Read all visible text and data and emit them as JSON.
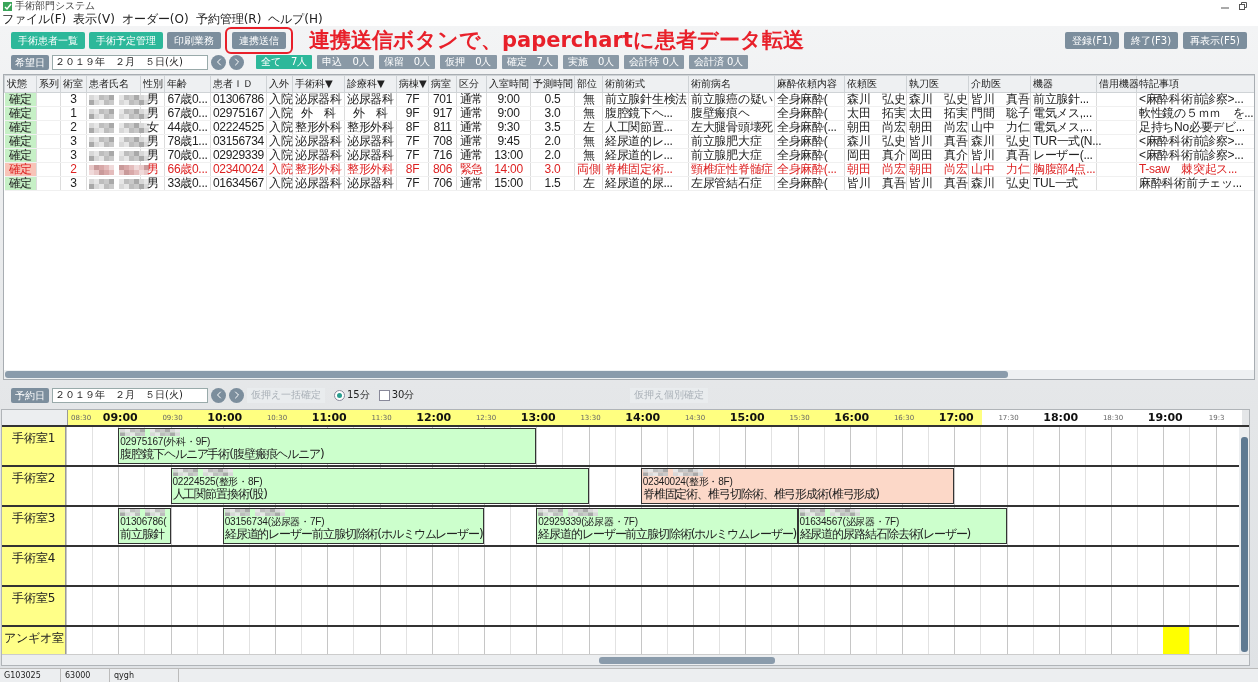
{
  "window": {
    "title": "手術部門システム"
  },
  "menu": [
    "ファイル(F)",
    "表示(V)",
    "オーダー(O)",
    "予約管理(R)",
    "ヘルプ(H)"
  ],
  "toolbar": {
    "buttons": [
      {
        "label": "手術患者一覧",
        "kind": "nav",
        "highlighted": false
      },
      {
        "label": "手術予定管理",
        "kind": "nav",
        "highlighted": false
      },
      {
        "label": "印刷業務",
        "kind": "action",
        "highlighted": false
      },
      {
        "label": "連携送信",
        "kind": "action",
        "highlighted": true
      }
    ],
    "annotation": "連携送信ボタンで、paperchartに患者データ転送",
    "right_buttons": [
      "登録(F1)",
      "終了(F3)",
      "再表示(F5)"
    ]
  },
  "filter_bar": {
    "label": "希望日",
    "date": "２０１９年　２月　５日(火)",
    "filters": [
      {
        "label": "全て　7人",
        "selected": true
      },
      {
        "label": "申込　0人",
        "selected": false
      },
      {
        "label": "保留　0人",
        "selected": false
      },
      {
        "label": "仮押　0人",
        "selected": false
      },
      {
        "label": "確定　7人",
        "selected": false
      },
      {
        "label": "実施　0人",
        "selected": false
      },
      {
        "label": "会計待 0人",
        "selected": false
      },
      {
        "label": "会計済 0人",
        "selected": false
      }
    ]
  },
  "table": {
    "columns": [
      {
        "label": "状態",
        "kind": "text"
      },
      {
        "label": "系列",
        "kind": "text"
      },
      {
        "label": "術室",
        "kind": "text"
      },
      {
        "label": "患者氏名",
        "kind": "redacted"
      },
      {
        "label": "性別",
        "kind": "text"
      },
      {
        "label": "年齢",
        "kind": "text"
      },
      {
        "label": "患者ＩＤ",
        "kind": "text"
      },
      {
        "label": "入外",
        "kind": "text"
      },
      {
        "label": "手術科▼",
        "kind": "text"
      },
      {
        "label": "診療科▼",
        "kind": "text"
      },
      {
        "label": "病棟▼",
        "kind": "text"
      },
      {
        "label": "病室",
        "kind": "text"
      },
      {
        "label": "区分",
        "kind": "text"
      },
      {
        "label": "入室時間",
        "kind": "text"
      },
      {
        "label": "予測時間",
        "kind": "text"
      },
      {
        "label": "部位",
        "kind": "text"
      },
      {
        "label": "術前術式",
        "kind": "text"
      },
      {
        "label": "術前病名",
        "kind": "text"
      },
      {
        "label": "麻酔依頼内容",
        "kind": "text"
      },
      {
        "label": "依頼医",
        "kind": "text"
      },
      {
        "label": "執刀医",
        "kind": "text"
      },
      {
        "label": "介助医",
        "kind": "text"
      },
      {
        "label": "機器",
        "kind": "text"
      },
      {
        "label": "借用機器",
        "kind": "text"
      },
      {
        "label": "特記事項",
        "kind": "text"
      }
    ],
    "rows": [
      {
        "alert": false,
        "cells": [
          "確定",
          null,
          "3",
          null,
          "男",
          "67歳0...",
          "01306786",
          "入院",
          "泌尿器科",
          "泌尿器科",
          "7F",
          "701",
          "通常",
          "9:00",
          "0.5",
          "無",
          "前立腺針生検法",
          "前立腺癌の疑い",
          "全身麻酔(",
          "森川　弘史",
          "森川　弘史",
          "皆川　真吾",
          "前立腺針...",
          null,
          "<麻酔科術前診察>..."
        ]
      },
      {
        "alert": false,
        "cells": [
          "確定",
          null,
          "1",
          null,
          "男",
          "67歳0...",
          "02975167",
          "入院",
          "外　科",
          "外　科",
          "9F",
          "917",
          "通常",
          "9:00",
          "3.0",
          "無",
          "腹腔鏡下ヘ...",
          "腹壁瘢痕ヘ",
          "全身麻酔(",
          "太田　拓実",
          "太田　拓実",
          "門間　聡子",
          "電気メス,...",
          null,
          "軟性鏡の５ｍｍ　を..."
        ]
      },
      {
        "alert": false,
        "cells": [
          "確定",
          null,
          "2",
          null,
          "女",
          "44歳0...",
          "02224525",
          "入院",
          "整形外科",
          "整形外科",
          "8F",
          "811",
          "通常",
          "9:30",
          "3.5",
          "左",
          "人工関節置...",
          "左大腿骨頭壊死",
          "全身麻酔(...",
          "朝田　尚宏",
          "朝田　尚宏",
          "山中　力仁",
          "電気メス,...",
          null,
          "足持ちNo必要デビ..."
        ]
      },
      {
        "alert": false,
        "cells": [
          "確定",
          null,
          "3",
          null,
          "男",
          "78歳1...",
          "03156734",
          "入院",
          "泌尿器科",
          "泌尿器科",
          "7F",
          "708",
          "通常",
          "9:45",
          "2.0",
          "無",
          "経尿道的レ...",
          "前立腺肥大症",
          "全身麻酔(",
          "森川　弘史",
          "皆川　真吾",
          "森川　弘史",
          "TUR一式(N...",
          null,
          "<麻酔科術前診察>..."
        ]
      },
      {
        "alert": false,
        "cells": [
          "確定",
          null,
          "3",
          null,
          "男",
          "70歳0...",
          "02929339",
          "入院",
          "泌尿器科",
          "泌尿器科",
          "7F",
          "716",
          "通常",
          "13:00",
          "2.0",
          "無",
          "経尿道的レ...",
          "前立腺肥大症",
          "全身麻酔(",
          "岡田　真介",
          "岡田　真介",
          "皆川　真吾",
          "レーザー(...",
          null,
          "<麻酔科術前診察>..."
        ]
      },
      {
        "alert": true,
        "cells": [
          "確定",
          null,
          "2",
          null,
          "男",
          "66歳0...",
          "02340024",
          "入院",
          "整形外科",
          "整形外科",
          "8F",
          "806",
          "緊急",
          "14:00",
          "3.0",
          "両側",
          "脊椎固定術...",
          "頸椎症性脊髄症",
          "全身麻酔(...",
          "朝田　尚宏",
          "朝田　尚宏",
          "山中　力仁",
          "胸腹部4点...",
          null,
          "T-saw　棘突起ス..."
        ]
      },
      {
        "alert": false,
        "cells": [
          "確定",
          null,
          "3",
          null,
          "男",
          "33歳0...",
          "01634567",
          "入院",
          "泌尿器科",
          "泌尿器科",
          "7F",
          "706",
          "通常",
          "15:00",
          "1.5",
          "左",
          "経尿道的尿...",
          "左尿管結石症",
          "全身麻酔(",
          "皆川　真吾",
          "皆川　真吾",
          "森川　弘史",
          "TUL一式",
          null,
          "麻酔科術前チェッ..."
        ]
      }
    ]
  },
  "schedule": {
    "label": "予約日",
    "date": "２０１９年　２月　５日(火)",
    "bulk_confirm": {
      "label": "仮押え一括確定",
      "disabled": true
    },
    "options": [
      {
        "kind": "radio",
        "label": "15分",
        "checked": true
      },
      {
        "kind": "checkbox",
        "label": "30分",
        "checked": false
      }
    ],
    "individual_confirm": {
      "label": "仮押え個別確定",
      "disabled": true
    },
    "ticks": [
      {
        "label": "08:30",
        "kind": "half",
        "highlighted": true
      },
      {
        "label": "09:00",
        "kind": "hour",
        "highlighted": true
      },
      {
        "label": "09:30",
        "kind": "half",
        "highlighted": true
      },
      {
        "label": "10:00",
        "kind": "hour",
        "highlighted": true
      },
      {
        "label": "10:30",
        "kind": "half",
        "highlighted": true
      },
      {
        "label": "11:00",
        "kind": "hour",
        "highlighted": true
      },
      {
        "label": "11:30",
        "kind": "half",
        "highlighted": true
      },
      {
        "label": "12:00",
        "kind": "hour",
        "highlighted": true
      },
      {
        "label": "12:30",
        "kind": "half",
        "highlighted": true
      },
      {
        "label": "13:00",
        "kind": "hour",
        "highlighted": true
      },
      {
        "label": "13:30",
        "kind": "half",
        "highlighted": true
      },
      {
        "label": "14:00",
        "kind": "hour",
        "highlighted": true
      },
      {
        "label": "14:30",
        "kind": "half",
        "highlighted": true
      },
      {
        "label": "15:00",
        "kind": "hour",
        "highlighted": true
      },
      {
        "label": "15:30",
        "kind": "half",
        "highlighted": true
      },
      {
        "label": "16:00",
        "kind": "hour",
        "highlighted": true
      },
      {
        "label": "16:30",
        "kind": "half",
        "highlighted": true
      },
      {
        "label": "17:00",
        "kind": "hour",
        "highlighted": true
      },
      {
        "label": "17:30",
        "kind": "half",
        "highlighted": false
      },
      {
        "label": "18:00",
        "kind": "hour",
        "highlighted": false
      },
      {
        "label": "18:30",
        "kind": "half",
        "highlighted": false
      },
      {
        "label": "19:00",
        "kind": "hour",
        "highlighted": false
      },
      {
        "label": "19:3",
        "kind": "half",
        "highlighted": false
      }
    ],
    "rooms": [
      {
        "name": "手術室1",
        "blocks": [
          {
            "kind": "surgery",
            "color": "#ccffcc",
            "id_line": "02975167(外科・9F)",
            "procedure": "腹腔鏡下ヘルニア手術(腹壁瘢痕ヘルニア)"
          }
        ]
      },
      {
        "name": "手術室2",
        "blocks": [
          {
            "kind": "surgery",
            "color": "#ccffcc",
            "id_line": "02224525(整形・8F)",
            "procedure": "人工関節置換術(股)"
          },
          {
            "kind": "surgery",
            "color": "#fcd8c8",
            "id_line": "02340024(整形・8F)",
            "procedure": "脊椎固定術、椎弓切除術、椎弓形成術(椎弓形成)"
          }
        ]
      },
      {
        "name": "手術室3",
        "blocks": [
          {
            "kind": "surgery",
            "color": "#ccffcc",
            "id_line": "01306786(",
            "procedure": "前立腺針"
          },
          {
            "kind": "surgery",
            "color": "#ccffcc",
            "id_line": "03156734(泌尿器・7F)",
            "procedure": "経尿道的レーザー前立腺切除術(ホルミウムレーザー)"
          },
          {
            "kind": "surgery",
            "color": "#ccffcc",
            "id_line": "02929339(泌尿器・7F)",
            "procedure": "経尿道的レーザー前立腺切除術(ホルミウムレーザー)"
          },
          {
            "kind": "surgery",
            "color": "#ccffcc",
            "id_line": "01634567(泌尿器・7F)",
            "procedure": "経尿道的尿路結石除去術(レーザー)"
          }
        ]
      },
      {
        "name": "手術室4"
      },
      {
        "name": "手術室5"
      },
      {
        "name": "アンギオ室",
        "blocks": [
          {
            "kind": "marker",
            "color": "#ffff00"
          }
        ]
      }
    ]
  },
  "status_bar": [
    "G103025",
    "63000",
    "qygh"
  ]
}
